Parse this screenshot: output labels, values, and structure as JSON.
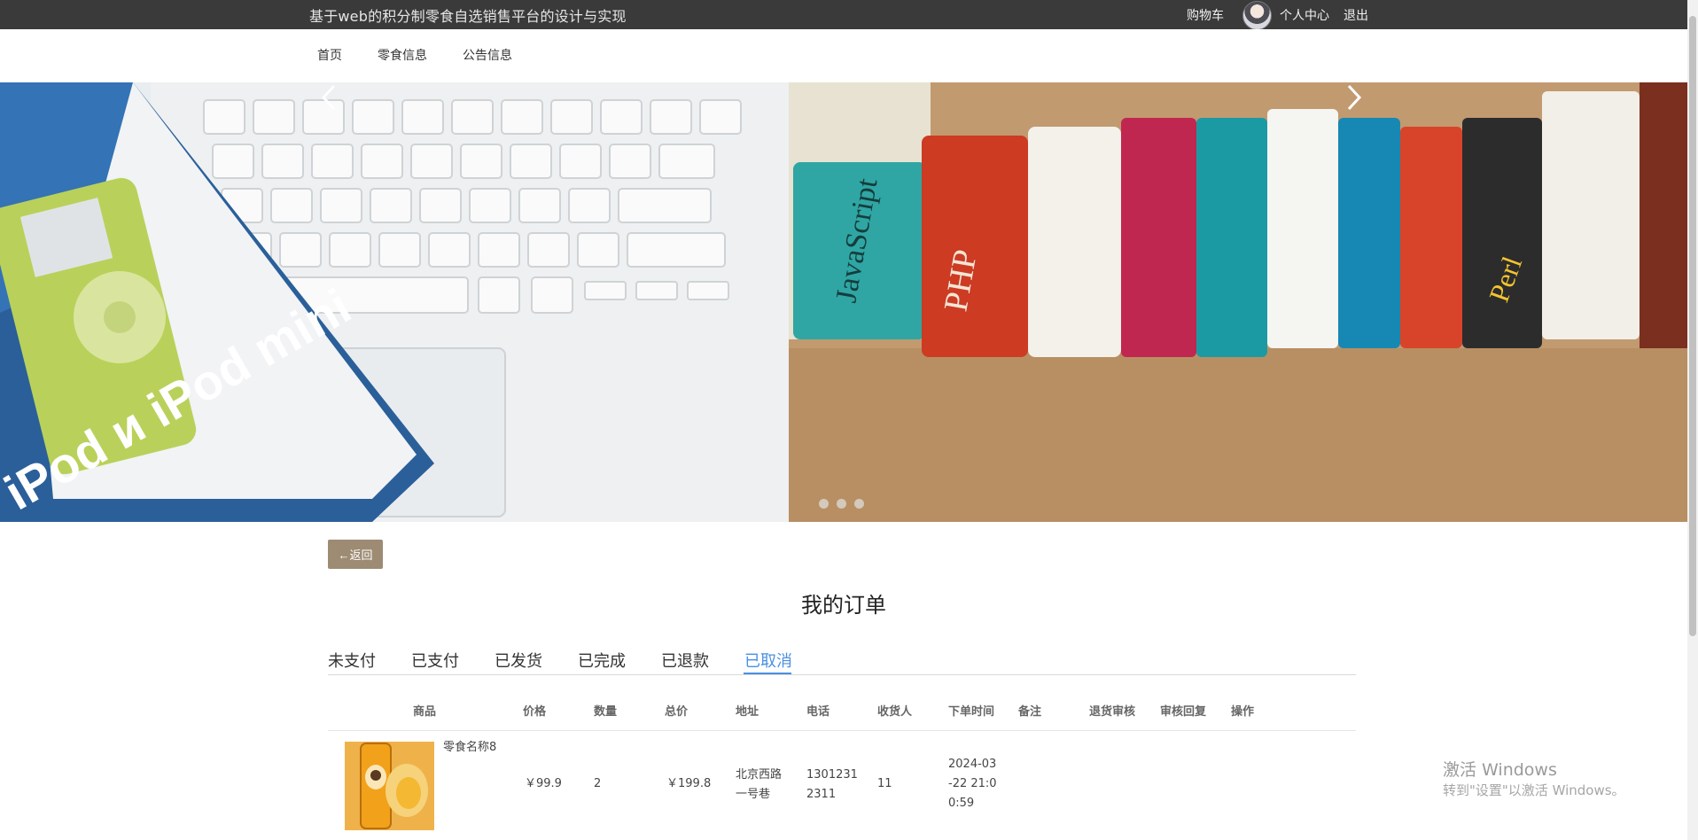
{
  "header": {
    "site_title": "基于web的积分制零食自选销售平台的设计与实现",
    "cart": "购物车",
    "profile": "个人中心",
    "logout": "退出"
  },
  "nav": {
    "items": [
      {
        "label": "首页"
      },
      {
        "label": "零食信息"
      },
      {
        "label": "公告信息"
      }
    ]
  },
  "carousel": {
    "image_text_1": "iPod и iPod mini",
    "image_text_2": "JavaScript",
    "image_text_3": "PHP",
    "image_text_4": "Perl",
    "slides_count": 3,
    "active_slide": 1
  },
  "back_button": {
    "icon": "←",
    "label": "返回"
  },
  "page_title": "我的订单",
  "tabs": [
    {
      "label": "未支付"
    },
    {
      "label": "已支付"
    },
    {
      "label": "已发货"
    },
    {
      "label": "已完成"
    },
    {
      "label": "已退款"
    },
    {
      "label": "已取消",
      "active": true
    }
  ],
  "table": {
    "headers": {
      "product": "商品",
      "price": "价格",
      "quantity": "数量",
      "total": "总价",
      "address": "地址",
      "phone": "电话",
      "receiver": "收货人",
      "order_time": "下单时间",
      "remark": "备注",
      "refund_review": "退货审核",
      "review_reply": "审核回复",
      "actions": "操作"
    },
    "rows": [
      {
        "product_name": "零食名称8",
        "price": "￥99.9",
        "quantity": "2",
        "total": "￥199.8",
        "address_line1": "北京西路",
        "address_line2": "一号巷",
        "phone_line1": "1301231",
        "phone_line2": "2311",
        "receiver": "11",
        "time_line1": "2024-03",
        "time_line2": "-22 21:0",
        "time_line3": "0:59",
        "remark": "",
        "refund_review": "",
        "review_reply": "",
        "actions": ""
      }
    ]
  },
  "watermark": {
    "line1": "激活 Windows",
    "line2": "转到\"设置\"以激活 Windows。"
  },
  "colors": {
    "topbar": "#3a3a3a",
    "back_button": "#9d8b73",
    "active_tab": "#4a90e2"
  },
  "icons": {
    "prev": "chevron-left-icon",
    "next": "chevron-right-icon",
    "avatar": "user-avatar"
  }
}
